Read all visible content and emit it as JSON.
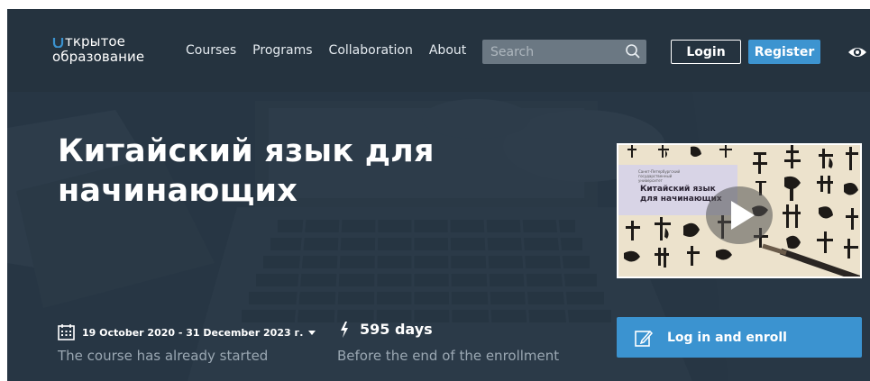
{
  "header": {
    "logo_line1": "ткрытое",
    "logo_line2": "образование",
    "nav": [
      "Courses",
      "Programs",
      "Collaboration",
      "About"
    ],
    "search_placeholder": "Search",
    "login_label": "Login",
    "register_label": "Register",
    "icons": {
      "search": "search-icon",
      "accessibility": "eye-icon"
    }
  },
  "course": {
    "title": "Китайский язык для начинающих",
    "video_title": "Китайский язык для начинающих",
    "dates": "19 October 2020 - 31 December 2023 г.",
    "dates_status": "The course has already started",
    "days_left": "595 days",
    "days_caption": "Before the end of the enrollment",
    "enroll_label": "Log in and enroll"
  },
  "colors": {
    "header_bg": "#25333f",
    "hero_bg": "#2a3a48",
    "accent": "#3b93d0"
  }
}
